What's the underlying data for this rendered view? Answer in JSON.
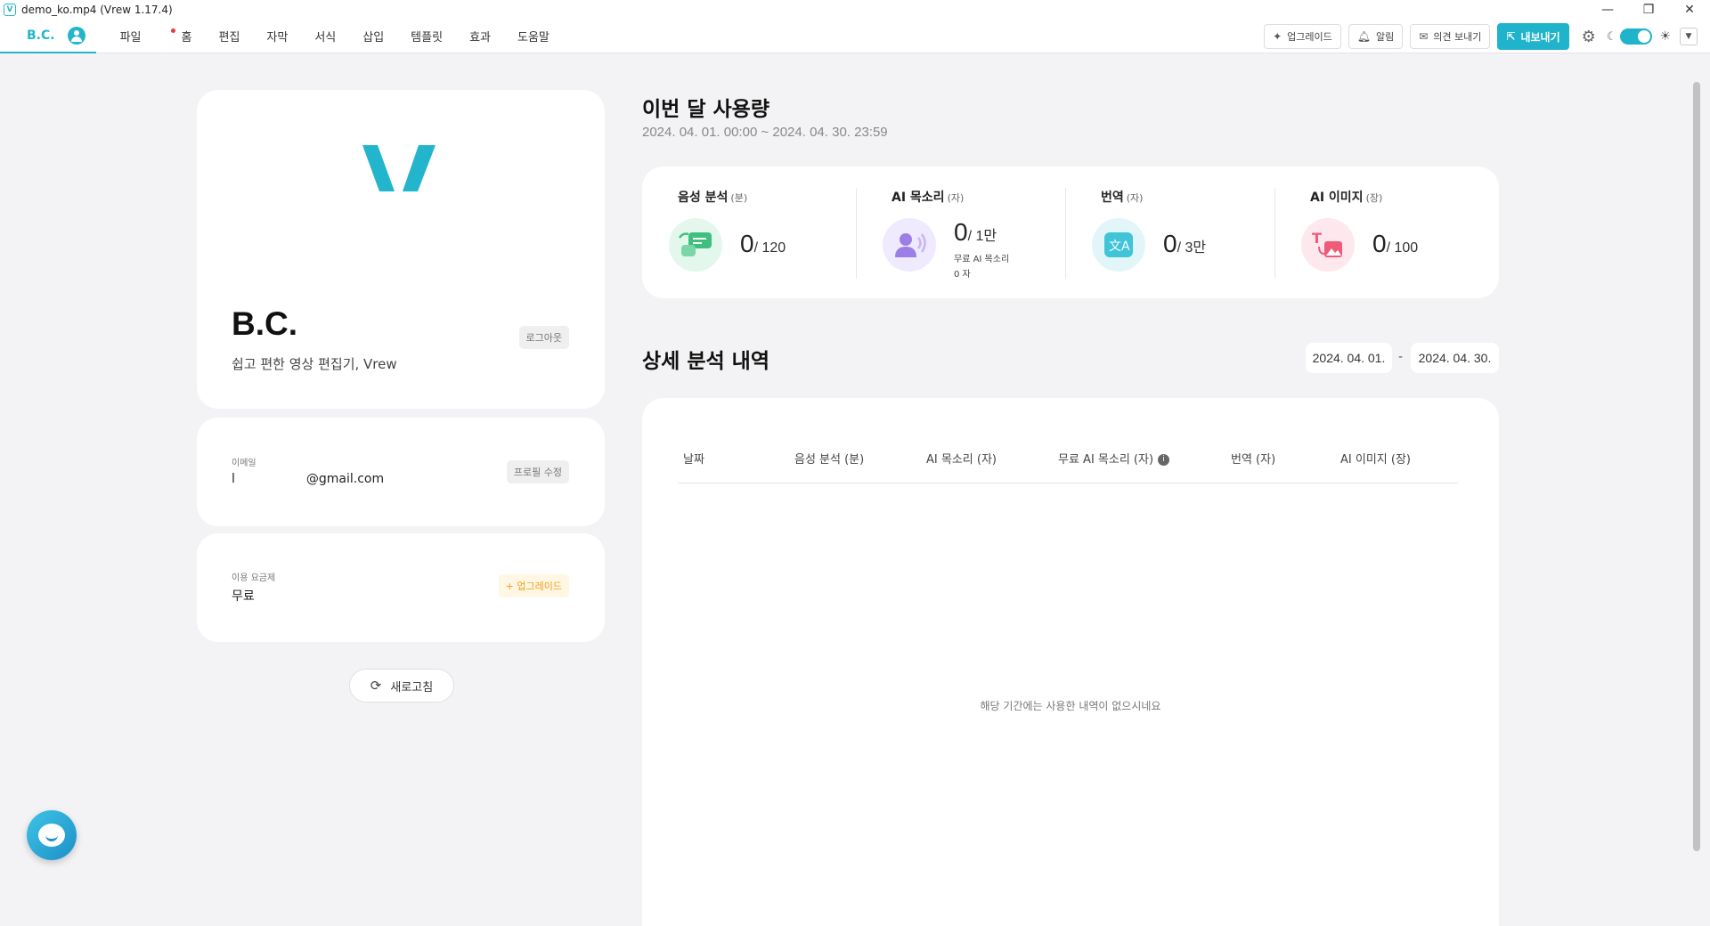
{
  "window": {
    "title": "demo_ko.mp4 (Vrew 1.17.4)",
    "app_icon_text": "V",
    "minimize_glyph": "—",
    "restore_glyph": "❐",
    "close_glyph": "✕"
  },
  "menubar": {
    "user_label": "B.C.",
    "items": [
      "파일",
      "홈",
      "편집",
      "자막",
      "서식",
      "삽입",
      "템플릿",
      "효과",
      "도움말"
    ],
    "upgrade_label": "업그레이드",
    "notifications_label": "알림",
    "feedback_label": "의견 보내기",
    "export_label": "내보내기"
  },
  "profile": {
    "name": "B.C.",
    "subtitle": "쉽고 편한 영상 편집기, Vrew",
    "logout_label": "로그아웃",
    "email_label": "이메일",
    "email_prefix": "l",
    "email_domain": "@gmail.com",
    "edit_profile_label": "프로필 수정",
    "plan_label": "이용 요금제",
    "plan_value": "무료",
    "upgrade_label": "+ 업그레이드",
    "refresh_label": "새로고침"
  },
  "usage": {
    "title": "이번 달 사용량",
    "range": "2024. 04. 01. 00:00 ~ 2024. 04. 30. 23:59",
    "stats": [
      {
        "label": "음성 분석",
        "unit": "(분)",
        "used": "0",
        "limit": "/ 120",
        "icon": "speech-analysis-icon",
        "color": "#3fbf7f",
        "bg": "#e3f7ec"
      },
      {
        "label": "AI 목소리",
        "unit": "(자)",
        "used": "0",
        "limit": "/ 1만",
        "sub_label": "무료 AI 목소리",
        "sub_value": "0 자",
        "icon": "ai-voice-icon",
        "color": "#9b7fe6",
        "bg": "#efeafd"
      },
      {
        "label": "번역",
        "unit": "(자)",
        "used": "0",
        "limit": "/ 3만",
        "icon": "translate-icon",
        "color": "#3fc4d8",
        "bg": "#e2f6f9"
      },
      {
        "label": "AI 이미지",
        "unit": "(장)",
        "used": "0",
        "limit": "/ 100",
        "icon": "ai-image-icon",
        "color": "#ef5a78",
        "bg": "#fde8ed"
      }
    ]
  },
  "detail": {
    "title": "상세 분석 내역",
    "date_from": "2024. 04. 01.",
    "date_sep": "-",
    "date_to": "2024. 04. 30.",
    "columns": [
      "날짜",
      "음성 분석 (분)",
      "AI 목소리 (자)",
      "무료 AI 목소리 (자)",
      "번역 (자)",
      "AI 이미지 (장)"
    ],
    "empty_message": "해당 기간에는 사용한 내역이 없으시네요"
  },
  "colors": {
    "accent": "#1fb3cc",
    "upgrade": "#f0a11a"
  }
}
